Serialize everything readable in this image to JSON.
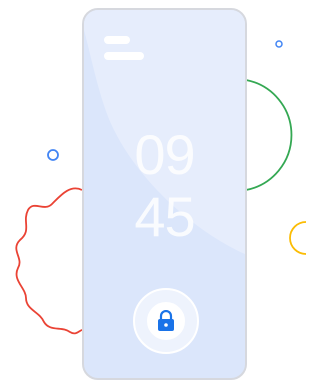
{
  "clock": {
    "hours": "09",
    "minutes": "45"
  },
  "icons": {
    "lock": "lock-icon"
  },
  "colors": {
    "phone_bg": "#dbe6fb",
    "phone_border": "#d6d8de",
    "lock_blue": "#1a73e8",
    "green": "#34a853",
    "yellow": "#fbbc04",
    "red": "#ea4335",
    "blue": "#4285f4"
  }
}
